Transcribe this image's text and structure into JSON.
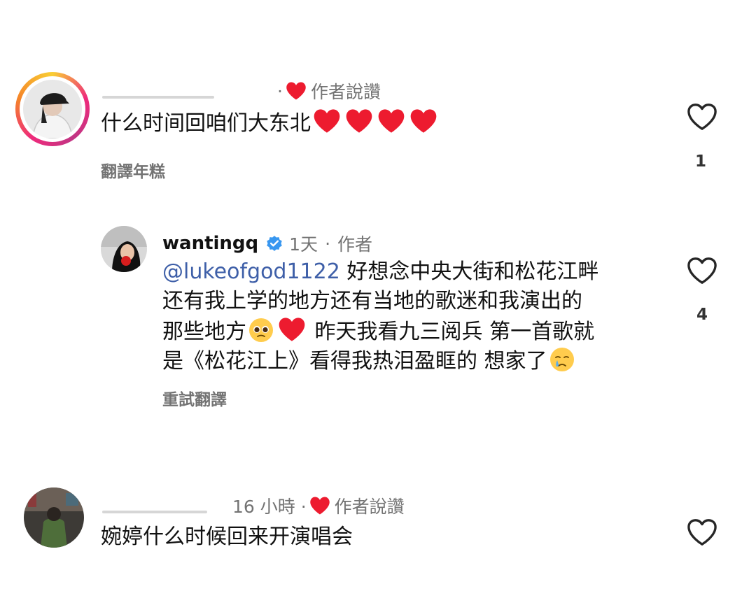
{
  "comments": [
    {
      "meta_suffix": "· ",
      "author_liked": "作者說讚",
      "text": "什么时间回咱们大东北",
      "action": "翻譯年糕",
      "like_count": "1"
    },
    {
      "username": "wantingq",
      "time": "1天",
      "separator": "·",
      "author_tag": "作者",
      "mention": "@lukeofgod1122",
      "line1": " 好想念中央大街和松花江畔",
      "line2": "还有我上学的地方还有当地的歌迷和我演出的",
      "line3a": "那些地方",
      "line3b": " 昨天我看九三阅兵 第一首歌就",
      "line4a": "是《松花江上》看得我热泪盈眶的 想家了",
      "action": "重試翻譯",
      "like_count": "4"
    },
    {
      "time": "16 小時 ·",
      "author_liked": "作者說讚",
      "text": "婉婷什么时候回来开演唱会"
    }
  ],
  "icons": {
    "heart_red": "#ed1b2f",
    "like_outline": "#262626",
    "verified": "#3897f0"
  }
}
